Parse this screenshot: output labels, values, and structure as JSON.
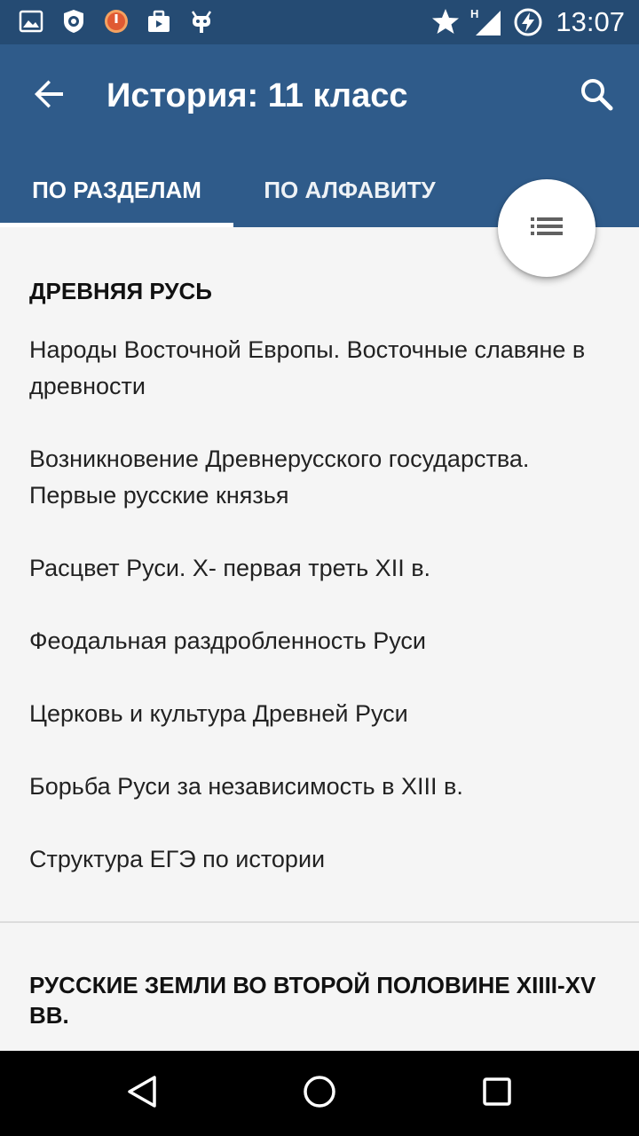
{
  "status_bar": {
    "time": "13:07",
    "network_label": "H",
    "icons": [
      "image-notification-icon",
      "shield-app-icon",
      "power-app-icon",
      "briefcase-icon",
      "android-debug-icon",
      "star-icon",
      "signal-icon",
      "battery-charging-icon"
    ]
  },
  "app_bar": {
    "title": "История: 11 класс",
    "back_icon": "arrow-back-icon",
    "search_icon": "search-icon"
  },
  "tabs": [
    {
      "label": "ПО РАЗДЕЛАМ",
      "selected": true
    },
    {
      "label": "ПО АЛФАВИТУ",
      "selected": false
    }
  ],
  "fab": {
    "icon": "list-icon"
  },
  "sections": [
    {
      "title": "ДРЕВНЯЯ РУСЬ",
      "items": [
        "Народы Восточной Европы. Восточные славяне в древности",
        "Возникновение Древнерусского государства. Первые русские князья",
        "Расцвет Руси. X- первая треть XII в.",
        "Феодальная раздробленность Руси",
        "Церковь и культура Древней Руси",
        "Борьба Руси за независимость в XIII в.",
        "Структура ЕГЭ по истории"
      ]
    },
    {
      "title": "РУССКИЕ ЗЕМЛИ ВО ВТОРОЙ ПОЛОВИНЕ XIIII-XV ВВ.",
      "items": []
    }
  ],
  "colors": {
    "status_bar": "#254b73",
    "app_bar": "#2f5b8a",
    "background": "#f5f5f5",
    "nav_bar": "#000000"
  },
  "nav_bar": {
    "icons": [
      "back-triangle-icon",
      "home-circle-icon",
      "recents-square-icon"
    ]
  }
}
